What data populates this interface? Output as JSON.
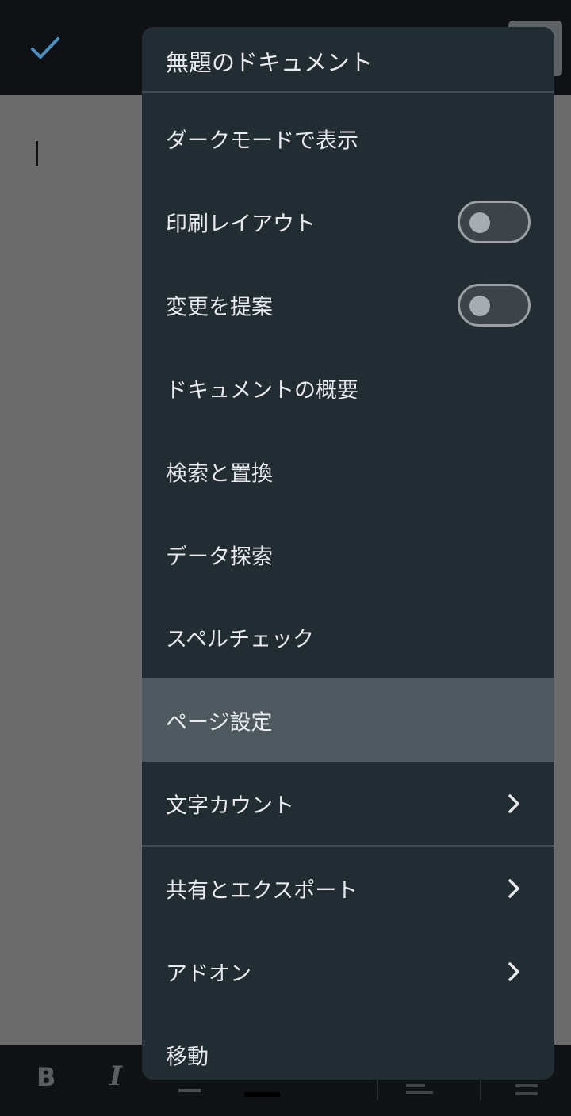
{
  "app": {
    "toolbar": {
      "done_icon": "check-icon",
      "colors": {
        "accent": "#4a90c2"
      }
    },
    "format_bar": {
      "bold": "B",
      "italic": "I",
      "text_color_swatch": "#000000"
    }
  },
  "menu": {
    "title": "無題のドキュメント",
    "items": [
      {
        "label": "ダークモードで表示"
      },
      {
        "label": "印刷レイアウト",
        "toggle": false
      },
      {
        "label": "変更を提案",
        "toggle": false
      },
      {
        "label": "ドキュメントの概要"
      },
      {
        "label": "検索と置換"
      },
      {
        "label": "データ探索"
      },
      {
        "label": "スペルチェック"
      },
      {
        "label": "ページ設定",
        "highlighted": true
      },
      {
        "label": "文字カウント",
        "submenu": true
      },
      {
        "label": "共有とエクスポート",
        "submenu": true
      },
      {
        "label": "アドオン",
        "submenu": true
      },
      {
        "label": "移動"
      }
    ]
  }
}
